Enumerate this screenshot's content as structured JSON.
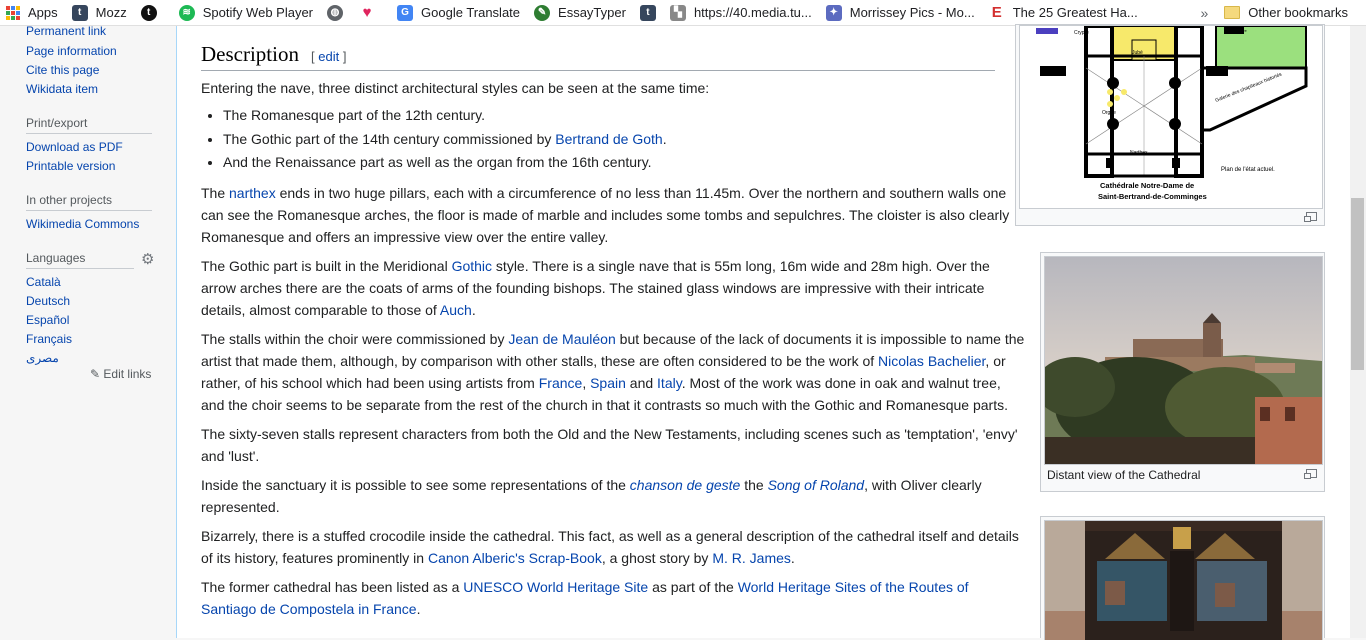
{
  "bookmarks": {
    "apps": "Apps",
    "items": [
      "Mozz",
      "Spotify Web Player",
      "Google Translate",
      "EssayTyper",
      "https://40.media.tu...",
      "Morrissey Pics - Mo...",
      "The 25 Greatest Ha..."
    ],
    "chevron": "»",
    "other": "Other bookmarks"
  },
  "sidebar": {
    "tools": [
      "Permanent link",
      "Page information",
      "Cite this page",
      "Wikidata item"
    ],
    "print_head": "Print/export",
    "print": [
      "Download as PDF",
      "Printable version"
    ],
    "projects_head": "In other projects",
    "projects": [
      "Wikimedia Commons"
    ],
    "languages_head": "Languages",
    "languages": [
      "Català",
      "Deutsch",
      "Español",
      "Français",
      "مصرى"
    ],
    "edit_links": "Edit links",
    "gear_icon": "gear-icon"
  },
  "article": {
    "heading": "Description",
    "edit_open": "[",
    "edit": "edit",
    "edit_close": "]",
    "intro": "Entering the nave, three distinct architectural styles can be seen at the same time:",
    "b1": "The Romanesque part of the 12th century.",
    "b2_pre": "The Gothic part of the 14th century commissioned by ",
    "b2_link": "Bertrand de Goth",
    "b2_post": ".",
    "b3": "And the Renaissance part as well as the organ from the 16th century.",
    "p1_pre": "The ",
    "p1_link": "narthex",
    "p1_post": " ends in two huge pillars, each with a circumference of no less than 11.45m. Over the northern and southern walls one can see the Romanesque arches, the floor is made of marble and includes some tombs and sepulchres. The cloister is also clearly Romanesque and offers an impressive view over the entire valley.",
    "p2_pre": "The Gothic part is built in the Meridional ",
    "p2_link1": "Gothic",
    "p2_mid": " style. There is a single nave that is 55m long, 16m wide and 28m high. Over the arrow arches there are the coats of arms of the founding bishops. The stained glass windows are impressive with their intricate details, almost comparable to those of ",
    "p2_link2": "Auch",
    "p2_post": ".",
    "p3_pre": "The stalls within the choir were commissioned by ",
    "p3_link1": "Jean de Mauléon",
    "p3_mid1": " but because of the lack of documents it is impossible to name the artist that made them, although, by comparison with other stalls, these are often considered to be the work of ",
    "p3_link2": "Nicolas Bachelier",
    "p3_mid2": ", or rather, of his school which had been using artists from ",
    "p3_link3": "France",
    "p3_comma": ", ",
    "p3_link4": "Spain",
    "p3_and": " and ",
    "p3_link5": "Italy",
    "p3_post": ". Most of the work was done in oak and walnut tree, and the choir seems to be separate from the rest of the church in that it contrasts so much with the Gothic and Romanesque parts.",
    "p4": "The sixty-seven stalls represent characters from both the Old and the New Testaments, including scenes such as 'temptation', 'envy' and 'lust'.",
    "p5_pre": "Inside the sanctuary it is possible to see some representations of the ",
    "p5_link1": "chanson de geste",
    "p5_mid": " the ",
    "p5_link2": "Song of Roland",
    "p5_post": ", with Oliver clearly represented.",
    "p6_pre": "Bizarrely, there is a stuffed crocodile inside the cathedral. This fact, as well as a general description of the cathedral itself and details of its history, features prominently in ",
    "p6_link1": "Canon Alberic's Scrap-Book",
    "p6_mid": ", a ghost story by ",
    "p6_link2": "M. R. James",
    "p6_post": ".",
    "p7_pre": "The former cathedral has been listed as a ",
    "p7_link1": "UNESCO World Heritage Site",
    "p7_mid": " as part of the ",
    "p7_link2": "World Heritage Sites of the Routes of Santiago de Compostela in France",
    "p7_post": "."
  },
  "plan": {
    "line1": "Cathédrale Notre-Dame de",
    "line2": "Saint-Bertrand-de-Comminges",
    "note": "Plan de l'état actuel.",
    "labels": [
      "Crypte",
      "Jubé",
      "Orgue",
      "Narthex",
      "Galerie des chapiteaux historiés",
      "Cloître"
    ]
  },
  "thumb2": {
    "caption": "Distant view of the Cathedral"
  },
  "colors": {
    "link": "#0645ad",
    "text": "#202122",
    "sidebar_bg": "#f6f6f6",
    "content_border": "#a7d7f9"
  }
}
